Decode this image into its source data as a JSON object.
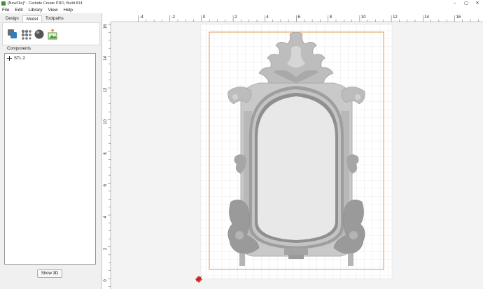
{
  "window": {
    "title": "[NewFile]* - Carbide Create PRO, Build 814",
    "controls": [
      "–",
      "▢",
      "✕"
    ]
  },
  "menu": [
    "File",
    "Edit",
    "Library",
    "View",
    "Help"
  ],
  "left_panel": {
    "tabs": [
      "Design",
      "Model",
      "Toolpaths"
    ],
    "active_tab": "Model",
    "section_label": "Components",
    "components": [
      "STL 2"
    ],
    "show3d_label": "Show 3D"
  },
  "ruler": {
    "h_labels": [
      "-4",
      "-2",
      "0",
      "2",
      "4",
      "6",
      "8",
      "10",
      "12",
      "14",
      "16"
    ],
    "v_labels": [
      "16",
      "14",
      "12",
      "10",
      "8",
      "6",
      "4",
      "2",
      "0"
    ]
  },
  "colors": {
    "accent_orange": "#f0a050",
    "stock_outline": "#e08c3a",
    "grid": "#dcdcdc",
    "origin_marker": "#d63030"
  }
}
